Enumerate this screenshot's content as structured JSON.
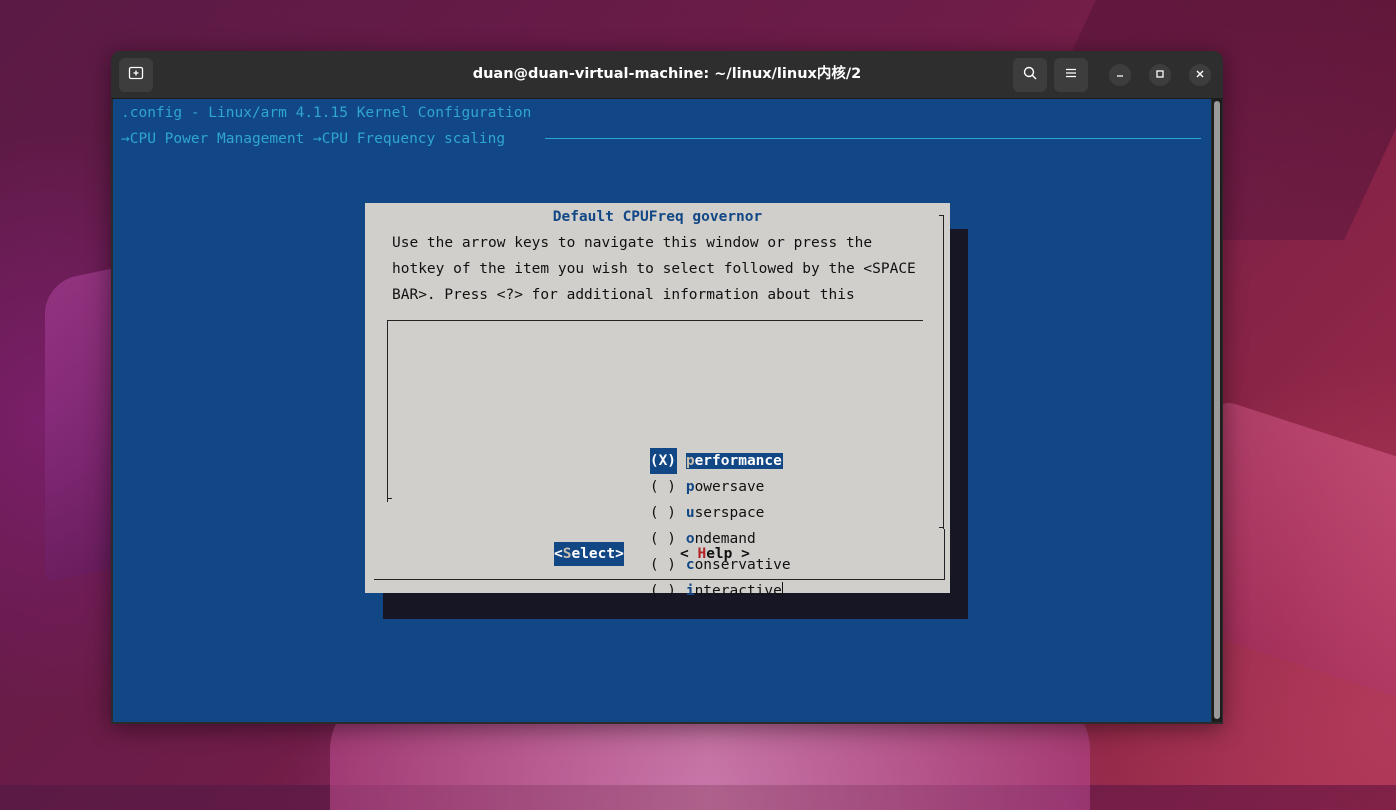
{
  "window": {
    "title": "duan@duan-virtual-machine: ~/linux/linux内核/2"
  },
  "terminal": {
    "config_title": ".config - Linux/arm 4.1.15 Kernel Configuration",
    "breadcrumb": "→CPU Power Management →CPU Frequency scaling"
  },
  "dialog": {
    "title": "Default CPUFreq governor",
    "help_lines": [
      "Use the arrow keys to navigate this window or press the",
      "hotkey of the item you wish to select followed by the <SPACE",
      "BAR>. Press <?> for additional information about this"
    ],
    "items": [
      {
        "mark": "(X)",
        "hotkey": "p",
        "rest": "erformance",
        "selected": true
      },
      {
        "mark": "( )",
        "hotkey": "p",
        "rest": "owersave",
        "selected": false
      },
      {
        "mark": "( )",
        "hotkey": "u",
        "rest": "serspace",
        "selected": false
      },
      {
        "mark": "( )",
        "hotkey": "o",
        "rest": "ndemand",
        "selected": false
      },
      {
        "mark": "( )",
        "hotkey": "c",
        "rest": "onservative",
        "selected": false
      },
      {
        "mark": "( )",
        "hotkey": "i",
        "rest": "nteractive",
        "selected": false
      }
    ],
    "buttons": {
      "select": {
        "open": "<",
        "hotkey": "S",
        "rest": "elect>"
      },
      "help": {
        "open": "< ",
        "hotkey": "H",
        "rest": "elp >"
      }
    }
  },
  "icons": {
    "new_tab": "new-tab-icon",
    "search": "search-icon",
    "menu": "hamburger-menu-icon",
    "minimize": "minimize-icon",
    "maximize": "maximize-icon",
    "close": "close-icon"
  },
  "colors": {
    "terminal_bg": "#124785",
    "dialog_bg": "#d1cfcb",
    "accent_text": "#2fa6cf",
    "hotkey_help": "#b22222"
  }
}
